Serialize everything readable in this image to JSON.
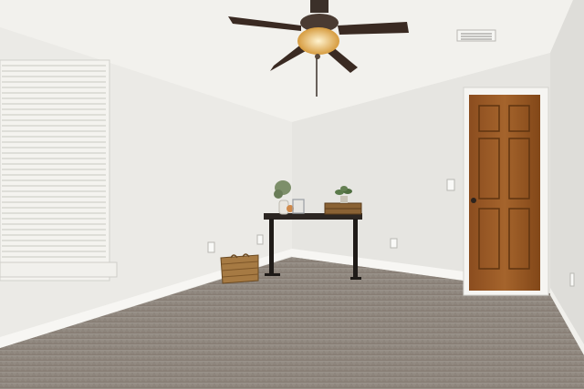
{
  "scene": {
    "description_free": true,
    "colors": {
      "ceiling": "#f1f0ec",
      "left_wall": "#ecebe7",
      "back_wall": "#e7e6e2",
      "right_wall": "#e3e2de",
      "carpet": "#8e857c",
      "door_wood": "#9a5a26",
      "table_top": "#2c2622",
      "basket": "#a67a43",
      "fan_blade": "#3a2a22",
      "light_glow": "#e8b960"
    },
    "objects": [
      "ceiling-fan",
      "window-blinds",
      "wood-door",
      "console-table",
      "wicker-basket",
      "potted-plant",
      "air-vent",
      "light-switch",
      "wall-outlets"
    ]
  }
}
